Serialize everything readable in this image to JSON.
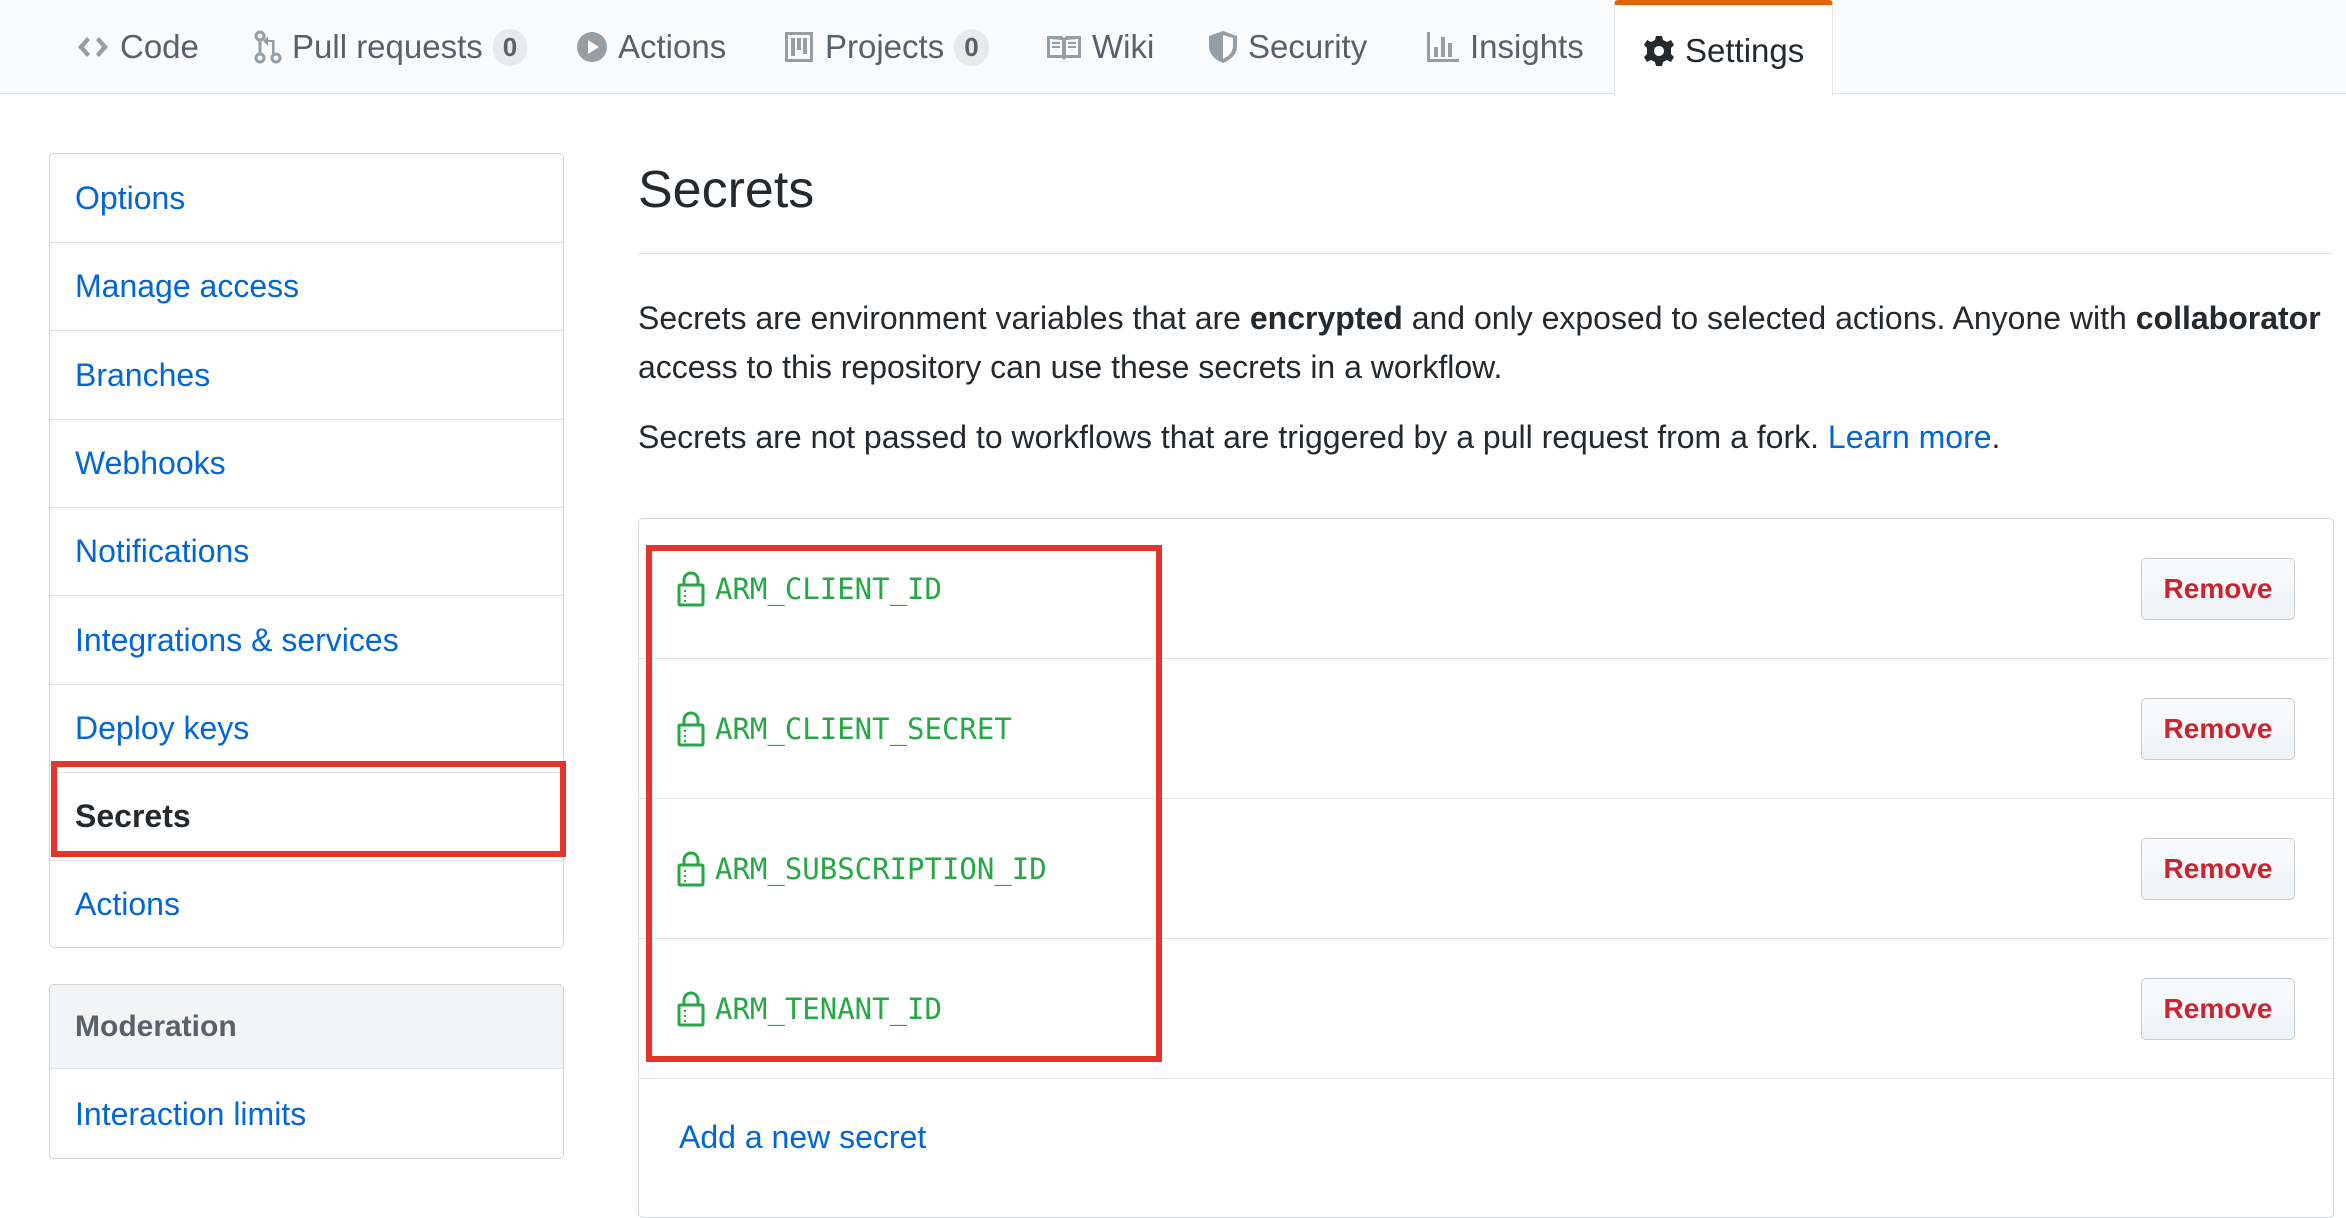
{
  "reponav": {
    "tabs": [
      {
        "label": "Code",
        "icon": "code-icon"
      },
      {
        "label": "Pull requests",
        "icon": "pull-request-icon",
        "count": "0"
      },
      {
        "label": "Actions",
        "icon": "play-icon"
      },
      {
        "label": "Projects",
        "icon": "project-icon",
        "count": "0"
      },
      {
        "label": "Wiki",
        "icon": "book-icon"
      },
      {
        "label": "Security",
        "icon": "shield-icon"
      },
      {
        "label": "Insights",
        "icon": "graph-icon"
      },
      {
        "label": "Settings",
        "icon": "gear-icon",
        "selected": true
      }
    ]
  },
  "sidebar": {
    "items": [
      {
        "label": "Options"
      },
      {
        "label": "Manage access"
      },
      {
        "label": "Branches"
      },
      {
        "label": "Webhooks"
      },
      {
        "label": "Notifications"
      },
      {
        "label": "Integrations & services"
      },
      {
        "label": "Deploy keys"
      },
      {
        "label": "Secrets",
        "selected": true
      },
      {
        "label": "Actions"
      }
    ],
    "moderation": {
      "heading": "Moderation",
      "items": [
        {
          "label": "Interaction limits"
        }
      ]
    }
  },
  "main": {
    "title": "Secrets",
    "intro": {
      "p1_a": "Secrets are environment variables that are ",
      "p1_b": "encrypted",
      "p1_c": " and only exposed to selected actions. Anyone with ",
      "p1_d": "collaborator",
      "p1_e": " access to this repository can use these secrets in a workflow.",
      "p2_a": "Secrets are not passed to workflows that are triggered by a pull request from a fork. ",
      "p2_link": "Learn more",
      "p2_end": "."
    },
    "secrets": [
      {
        "name": "ARM_CLIENT_ID",
        "button": "Remove"
      },
      {
        "name": "ARM_CLIENT_SECRET",
        "button": "Remove"
      },
      {
        "name": "ARM_SUBSCRIPTION_ID",
        "button": "Remove"
      },
      {
        "name": "ARM_TENANT_ID",
        "button": "Remove"
      }
    ],
    "add_link": "Add a new secret"
  },
  "colors": {
    "link": "#0366d6",
    "secret_green": "#28a745",
    "remove_red": "#cb2431",
    "selected_tab_accent": "#e36209",
    "highlight_box": "#e5342a"
  }
}
